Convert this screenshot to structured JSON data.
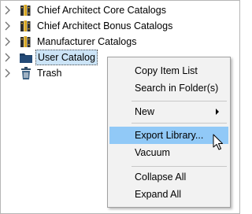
{
  "tree": {
    "items": [
      {
        "label": "Chief Architect Core Catalogs",
        "icon": "books-icon"
      },
      {
        "label": "Chief Architect Bonus Catalogs",
        "icon": "books-icon"
      },
      {
        "label": "Manufacturer Catalogs",
        "icon": "books-icon"
      },
      {
        "label": "User Catalog",
        "icon": "folder-icon"
      },
      {
        "label": "Trash",
        "icon": "trash-icon"
      }
    ]
  },
  "context_menu": {
    "items": [
      {
        "label": "Copy Item List"
      },
      {
        "label": "Search in Folder(s)"
      },
      {
        "label": "New"
      },
      {
        "label": "Export Library..."
      },
      {
        "label": "Vacuum"
      },
      {
        "label": "Collapse All"
      },
      {
        "label": "Expand All"
      }
    ]
  },
  "colors": {
    "selection": "#cce4f7",
    "menu_hover": "#91c9f7",
    "menu_background": "#f2f2f2",
    "folder": "#1e3f66"
  }
}
